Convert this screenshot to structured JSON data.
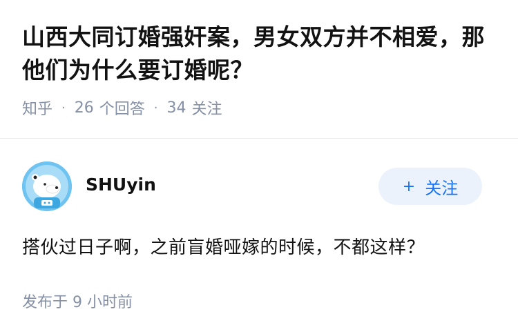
{
  "question": {
    "title": "山西大同订婚强奸案，男女双方并不相爱，那他们为什么要订婚呢？",
    "source": "知乎",
    "answer_count": "26",
    "answer_label": "个回答",
    "follower_count": "34",
    "follower_label": "关注"
  },
  "answer": {
    "author_name": "SHUyin",
    "avatar_icon": "polar-bear-avatar",
    "follow_button_label": "关注",
    "follow_icon": "plus-icon",
    "content": "搭伙过日子啊，之前盲婚哑嫁的时候，不都这样？",
    "publish_time": "发布于 9 小时前"
  },
  "colors": {
    "accent": "#1772f6",
    "follow_bg": "#ebf2fb",
    "meta": "#8590a6",
    "text": "#121212"
  }
}
